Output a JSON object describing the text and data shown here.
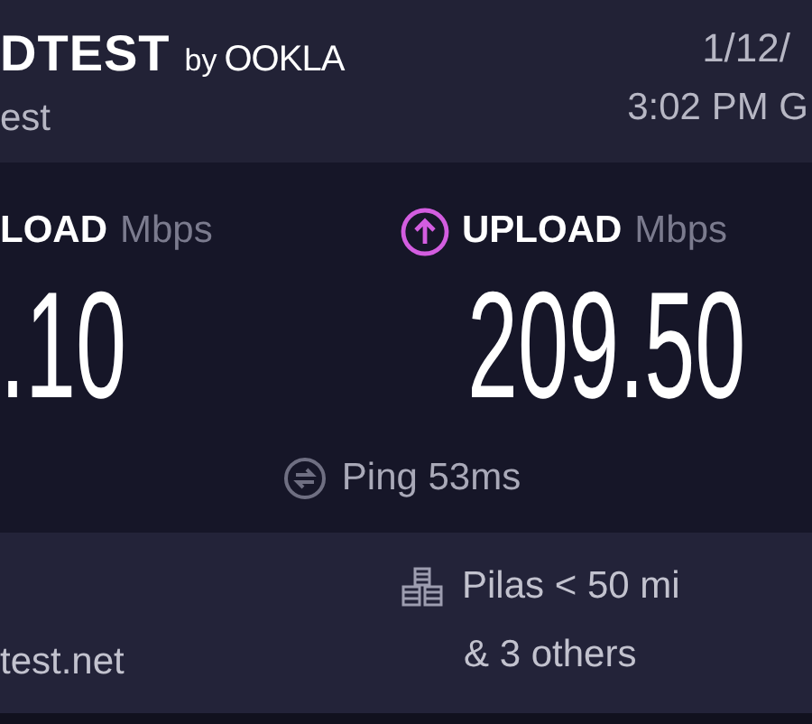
{
  "header": {
    "brand": "DTEST",
    "brand_by": "by",
    "brand_logo": "OOKLA",
    "subtitle": "est",
    "date": "1/12/",
    "time": "3:02 PM G"
  },
  "results": [
    {
      "kind": "download",
      "label": "LOAD",
      "unit": "Mbps",
      "value": ".10"
    },
    {
      "kind": "upload",
      "label": "UPLOAD",
      "unit": "Mbps",
      "value": "209.50"
    }
  ],
  "ping": {
    "label": "Ping 53ms"
  },
  "server": {
    "host": "test.net",
    "location": "Pilas < 50 mi",
    "others": "& 3 others"
  }
}
